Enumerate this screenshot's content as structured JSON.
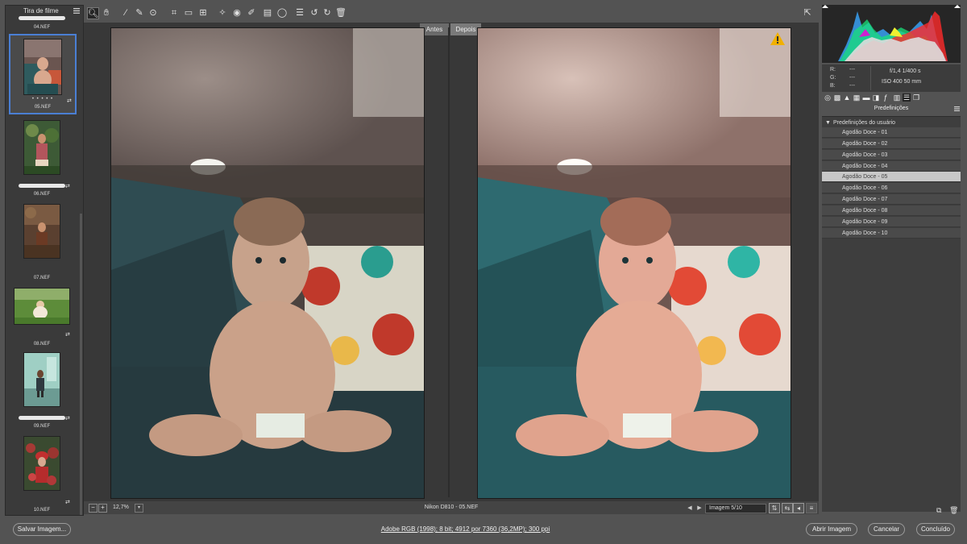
{
  "filmstrip": {
    "title": "Tira de filme",
    "items": [
      {
        "name": "04.NEF"
      },
      {
        "name": "05.NEF",
        "selected": true,
        "rating": "• • • • •"
      },
      {
        "name": "06.NEF"
      },
      {
        "name": "07.NEF"
      },
      {
        "name": "08.NEF"
      },
      {
        "name": "09.NEF"
      },
      {
        "name": "10.NEF"
      }
    ]
  },
  "toolbar": {
    "icons": [
      "zoom-icon",
      "hand-icon",
      "white-balance-icon",
      "color-sampler-icon",
      "target-adjust-icon",
      "crop-icon",
      "straighten-icon",
      "transform-icon",
      "spot-removal-icon",
      "red-eye-icon",
      "adjustment-brush-icon",
      "graduated-filter-icon",
      "radial-filter-icon",
      "preferences-icon",
      "rotate-left-icon",
      "rotate-right-icon",
      "trash-icon",
      "open-fullscreen-icon"
    ]
  },
  "preview": {
    "before_label": "Antes",
    "after_label": "Depois"
  },
  "statusbar": {
    "zoom": "12,7%",
    "camera_info": "Nikon D810  -  05.NEF",
    "image_counter": "Imagem 5/10"
  },
  "readout": {
    "r_label": "R:",
    "g_label": "G:",
    "b_label": "B:",
    "r_value": "---",
    "g_value": "---",
    "b_value": "---",
    "aperture_shutter": "f/1,4    1/400 s",
    "iso_focal": "ISO 400    50 mm"
  },
  "presets": {
    "panel_title": "Predefinições",
    "group_label": "Predefinições do usuário",
    "items": [
      "Agodão Doce - 01",
      "Agodão Doce - 02",
      "Agodão Doce - 03",
      "Agodão Doce - 04",
      "Agodão Doce - 05",
      "Agodão Doce - 06",
      "Agodão Doce - 07",
      "Agodão Doce - 08",
      "Agodão Doce - 09",
      "Agodão Doce - 10"
    ],
    "selected_index": 4
  },
  "footer": {
    "save_label": "Salvar Imagem...",
    "info": "Adobe RGB (1998); 8 bit; 4912 por 7360 (36,2MP); 300 ppi",
    "open_label": "Abrir Imagem",
    "cancel_label": "Cancelar",
    "done_label": "Concluído"
  },
  "colors": {
    "accent_selected": "#4a7fd4",
    "warning": "#f0b000"
  }
}
